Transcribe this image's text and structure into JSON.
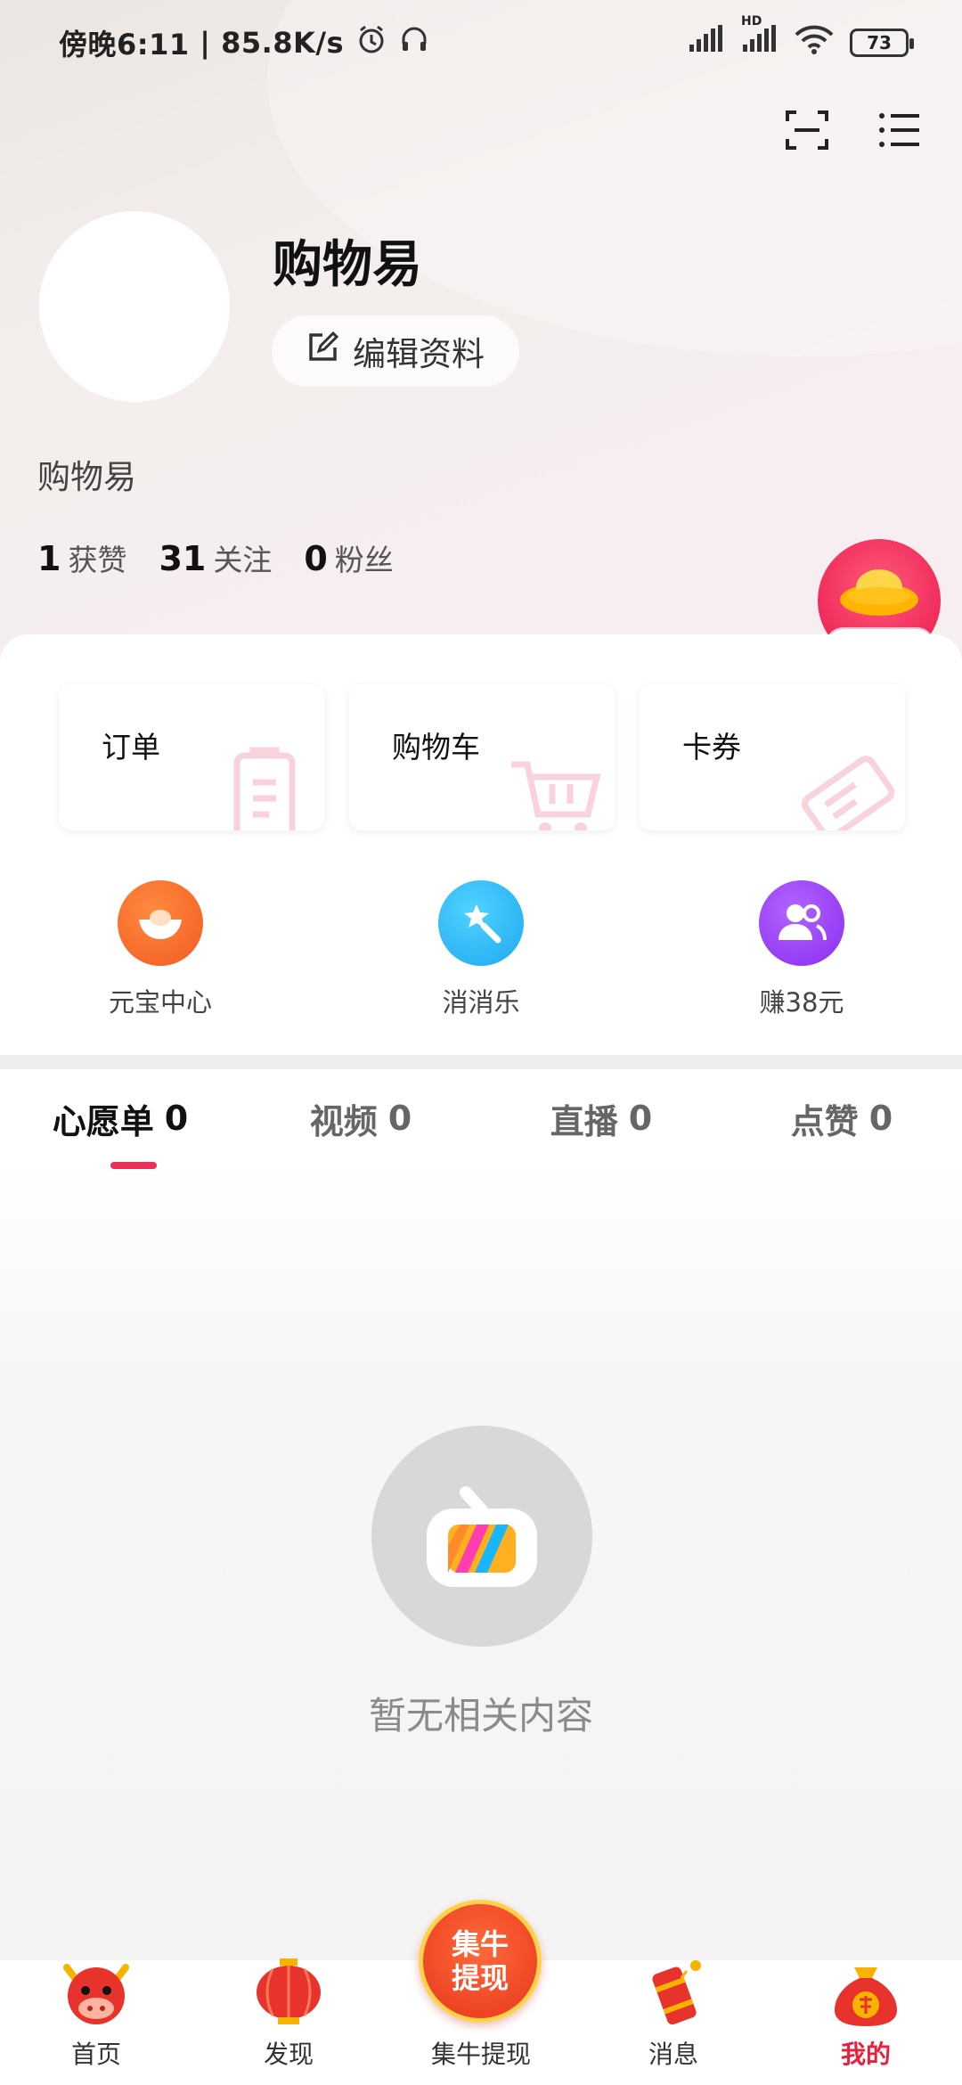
{
  "status_bar": {
    "time": "傍晚6:11",
    "speed": "85.8K/s",
    "battery": "73",
    "network_hd": "HD"
  },
  "profile": {
    "username": "购物易",
    "edit_label": "编辑资料",
    "bio": "购物易",
    "stats": [
      {
        "num": "1",
        "label": "获赞"
      },
      {
        "num": "31",
        "label": "关注"
      },
      {
        "num": "0",
        "label": "粉丝"
      }
    ],
    "yuanbao_badge": "元宝中心"
  },
  "cards": [
    {
      "label": "订单",
      "icon": "clipboard-icon"
    },
    {
      "label": "购物车",
      "icon": "cart-icon"
    },
    {
      "label": "卡券",
      "icon": "ticket-icon"
    }
  ],
  "shortcuts": [
    {
      "label": "元宝中心",
      "icon": "ingot-icon",
      "color": "#f25a22"
    },
    {
      "label": "消消乐",
      "icon": "magic-wand-icon",
      "color": "#1ea8f1"
    },
    {
      "label": "赚38元",
      "icon": "users-icon",
      "color": "#8a2cf0"
    }
  ],
  "tabs": [
    {
      "label": "心愿单",
      "count": "0",
      "active": true
    },
    {
      "label": "视频",
      "count": "0",
      "active": false
    },
    {
      "label": "直播",
      "count": "0",
      "active": false
    },
    {
      "label": "点赞",
      "count": "0",
      "active": false
    }
  ],
  "empty_state": {
    "text": "暂无相关内容"
  },
  "bottom_nav": {
    "items": [
      {
        "label": "首页",
        "icon": "ox-face-icon"
      },
      {
        "label": "发现",
        "icon": "lantern-icon"
      },
      {
        "label": "集牛提现",
        "icon": "cash-badge-icon"
      },
      {
        "label": "消息",
        "icon": "firecracker-icon"
      },
      {
        "label": "我的",
        "icon": "lucky-bag-icon",
        "active": true
      }
    ],
    "center_badge_line1": "集牛",
    "center_badge_line2": "提现"
  },
  "accent_color": "#ec2f58"
}
